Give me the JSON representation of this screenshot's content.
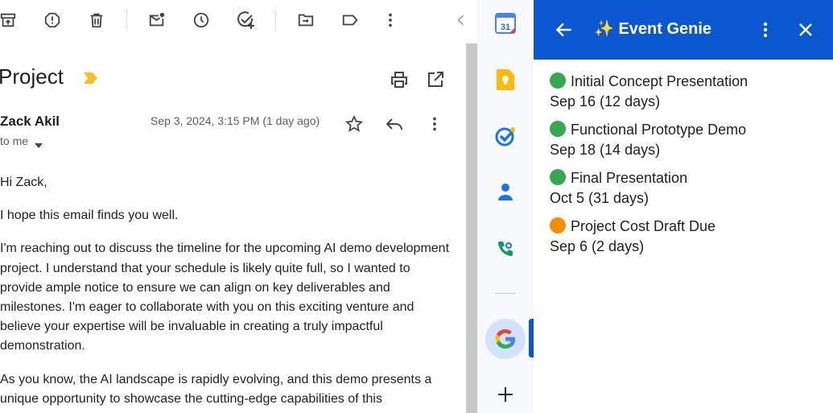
{
  "email": {
    "subject": "Project",
    "sender_name": "Zack Akil",
    "recipient": "to me",
    "date": "Sep 3, 2024, 3:15 PM (1 day ago)",
    "body": [
      "Hi Zack,",
      "I hope this email finds you well.",
      "I'm reaching out to discuss the timeline for the upcoming AI demo development project. I understand that your schedule is likely quite full, so I wanted to provide ample notice to ensure we can align on key deliverables and milestones. I'm eager to collaborate with you on this exciting venture and believe your expertise will be invaluable in creating a truly impactful demonstration.",
      "As you know, the AI landscape is rapidly evolving, and this demo presents a unique opportunity to showcase the cutting-edge capabilities of this"
    ],
    "label_color": "#f6bf26"
  },
  "toolbar": {
    "icons": [
      "archive-icon",
      "report-spam-icon",
      "delete-icon",
      "mark-unread-icon",
      "snooze-icon",
      "add-to-tasks-icon",
      "move-to-icon",
      "label-icon",
      "more-vert-icon"
    ]
  },
  "side_apps": {
    "calendar_day": "31",
    "items": [
      "calendar-icon",
      "keep-icon",
      "tasks-icon",
      "contacts-icon",
      "phone-icon",
      "event-genie-addon-icon",
      "add-icon"
    ]
  },
  "panel": {
    "title": "✨ Event Genie",
    "header_color": "#0b57d0",
    "events": [
      {
        "title": "Initial Concept Presentation",
        "date": "Sep 16 (12 days)",
        "status_color": "#34a853"
      },
      {
        "title": "Functional Prototype Demo",
        "date": "Sep 18 (14 days)",
        "status_color": "#34a853"
      },
      {
        "title": "Final Presentation",
        "date": "Oct 5 (31 days)",
        "status_color": "#34a853"
      },
      {
        "title": "Project Cost Draft Due",
        "date": "Sep 6 (2 days)",
        "status_color": "#fb8c00"
      }
    ]
  }
}
